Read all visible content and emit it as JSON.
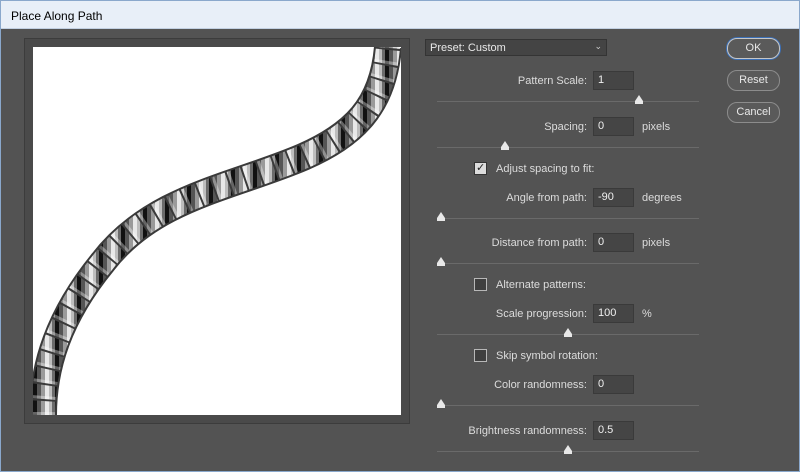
{
  "window": {
    "title": "Place Along Path"
  },
  "preset": {
    "label": "Preset:",
    "value": "Custom"
  },
  "buttons": {
    "ok": "OK",
    "reset": "Reset",
    "cancel": "Cancel"
  },
  "controls": {
    "pattern_scale": {
      "label": "Pattern Scale:",
      "value": "1",
      "unit": "",
      "slider": 0.78
    },
    "spacing": {
      "label": "Spacing:",
      "value": "0",
      "unit": "pixels",
      "slider": 0.25
    },
    "adjust_spacing": {
      "label": "Adjust spacing to fit:",
      "checked": true
    },
    "angle_from_path": {
      "label": "Angle from path:",
      "value": "-90",
      "unit": "degrees",
      "slider": 0.0
    },
    "distance_from_path": {
      "label": "Distance from path:",
      "value": "0",
      "unit": "pixels",
      "slider": 0.0
    },
    "alternate_patterns": {
      "label": "Alternate patterns:",
      "checked": false
    },
    "scale_progression": {
      "label": "Scale progression:",
      "value": "100",
      "unit": "%",
      "slider": 0.5
    },
    "skip_symbol_rotation": {
      "label": "Skip symbol rotation:",
      "checked": false
    },
    "color_randomness": {
      "label": "Color randomness:",
      "value": "0",
      "unit": "",
      "slider": 0.0
    },
    "brightness_randomness": {
      "label": "Brightness randomness:",
      "value": "0.5",
      "unit": "",
      "slider": 0.5
    }
  },
  "icons": {
    "dropdown": "chevron-down-icon",
    "checkbox_mark": "check-icon"
  }
}
